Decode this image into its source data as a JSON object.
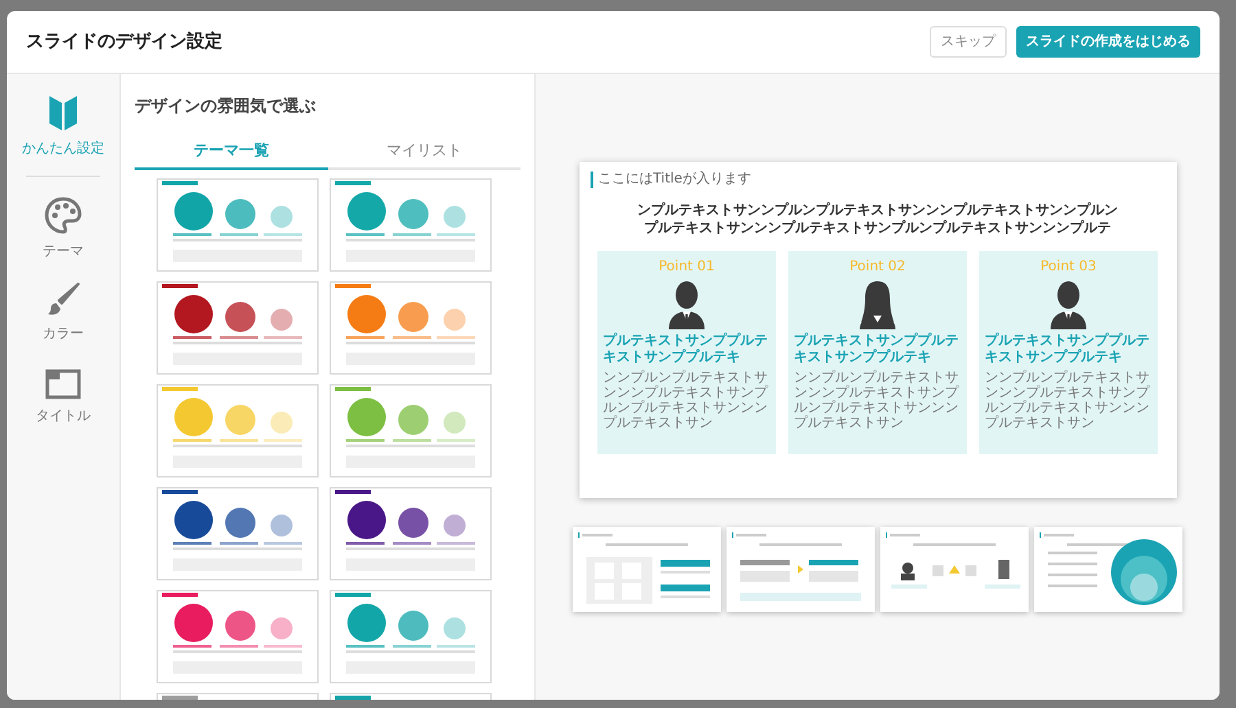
{
  "dialog": {
    "title": "スライドのデザイン設定",
    "buttons": [
      {
        "kind": "secondary",
        "label": "スキップ"
      },
      {
        "kind": "primary",
        "label": "スライドの作成をはじめる"
      }
    ]
  },
  "sidebar": {
    "items": [
      {
        "kind": "beginner",
        "label": "かんたん設定",
        "selected": true
      },
      {
        "kind": "palette",
        "label": "テーマ",
        "selected": false
      },
      {
        "kind": "brush",
        "label": "カラー",
        "selected": false
      },
      {
        "kind": "window",
        "label": "タイトル",
        "selected": false
      }
    ]
  },
  "theme_panel": {
    "heading": "デザインの雰囲気で選ぶ",
    "tabs": [
      {
        "label": "テーマ一覧",
        "selected": true
      },
      {
        "label": "マイリスト",
        "selected": false
      }
    ],
    "themes": [
      {
        "color": "#12a5a8"
      },
      {
        "color": "#14a8a8"
      },
      {
        "color": "#b3171f"
      },
      {
        "color": "#f57c14"
      },
      {
        "color": "#f4c831"
      },
      {
        "color": "#7cbf43"
      },
      {
        "color": "#184a9a"
      },
      {
        "color": "#4a1788"
      },
      {
        "color": "#e81c5f"
      },
      {
        "color": "#13a6a8"
      },
      {
        "color": "#9e9e9e"
      },
      {
        "color": "#14a3a8"
      }
    ]
  },
  "preview": {
    "slide": {
      "title": "ここにはTitleが入ります",
      "headline": [
        "ンプルテキストサンンプルンプルテキストサンンンプルテキストサンンプルン",
        "プルテキストサンンンプルテキストサンプルンプルテキストサンンンプルテ"
      ],
      "points": [
        {
          "label": "Point 01",
          "kind": "man",
          "heading": "プルテキストサンププルテキストサンププルテキ",
          "body": "ンンプルンプルテキストサンンンプルテキストサンプルンプルテキストサンンンプルテキストサン"
        },
        {
          "label": "Point 02",
          "kind": "woman",
          "heading": "プルテキストサンププルテキストサンププルテキ",
          "body": "ンンプルンプルテキストサンンンプルテキストサンプルンプルテキストサンンンプルテキストサン"
        },
        {
          "label": "Point 03",
          "kind": "man",
          "heading": "プルテキストサンププルテキストサンププルテキ",
          "body": "ンンプルンプルテキストサンンンプルテキストサンプルンプルテキストサンンンプルテキストサン"
        }
      ]
    },
    "thumbnails": [
      {
        "kind": "icons"
      },
      {
        "kind": "steps"
      },
      {
        "kind": "people"
      },
      {
        "kind": "circles"
      }
    ]
  }
}
